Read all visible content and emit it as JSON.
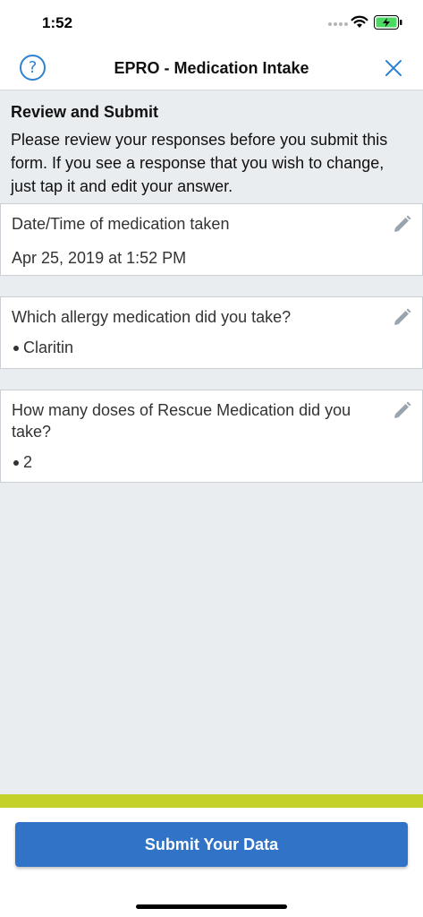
{
  "status_bar": {
    "time": "1:52",
    "battery_color": "#4cd964"
  },
  "header": {
    "title": "EPRO - Medication Intake",
    "help_glyph": "?",
    "accent_color": "#2f82d1"
  },
  "intro": {
    "title": "Review and Submit",
    "text": "Please review your responses before you submit this form. If you see a response that you wish to change, just tap it and edit your answer."
  },
  "responses": [
    {
      "question": "Date/Time of medication taken",
      "answer": "Apr 25, 2019 at 1:52 PM"
    },
    {
      "question": "Which allergy medication did you take?",
      "answers": [
        "Claritin"
      ]
    },
    {
      "question": "How many doses of Rescue Medication did you take?",
      "answers": [
        "2"
      ]
    }
  ],
  "footer": {
    "submit_label": "Submit Your Data",
    "accent_bar_color": "#c3d12a",
    "button_color": "#3174c7"
  },
  "icons": {
    "help": "help-icon",
    "close": "close-icon",
    "edit": "pencil-icon",
    "wifi": "wifi-icon",
    "battery": "battery-charging-icon"
  }
}
